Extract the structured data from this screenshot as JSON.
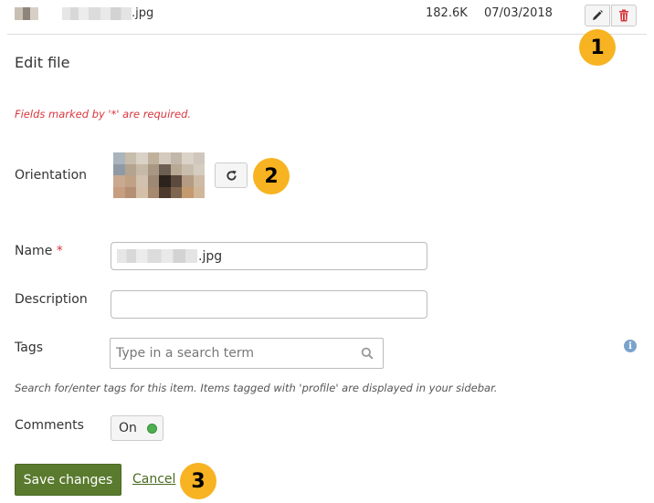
{
  "file_row": {
    "name_suffix": ".jpg",
    "size": "182.6K",
    "date": "07/03/2018"
  },
  "icons": {
    "edit": "pencil-icon",
    "delete": "trash-icon",
    "rotate": "rotate-icon",
    "search": "search-icon",
    "info": "info-icon"
  },
  "colors": {
    "callout": "#f7b321",
    "delete_red": "#d9363e",
    "save_green": "#5a7a2e",
    "toggle_on": "#4caf50"
  },
  "callouts": [
    "1",
    "2",
    "3"
  ],
  "form": {
    "title": "Edit file",
    "required_note": "Fields marked by '*' are required.",
    "orientation_label": "Orientation",
    "name_label": "Name",
    "name_required_mark": "*",
    "name_value_suffix": ".jpg",
    "description_label": "Description",
    "description_value": "",
    "tags_label": "Tags",
    "tags_placeholder": "Type in a search term",
    "tags_help": "Search for/enter tags for this item. Items tagged with 'profile' are displayed in your sidebar.",
    "comments_label": "Comments",
    "comments_toggle": "On",
    "save_label": "Save changes",
    "cancel_label": "Cancel"
  }
}
